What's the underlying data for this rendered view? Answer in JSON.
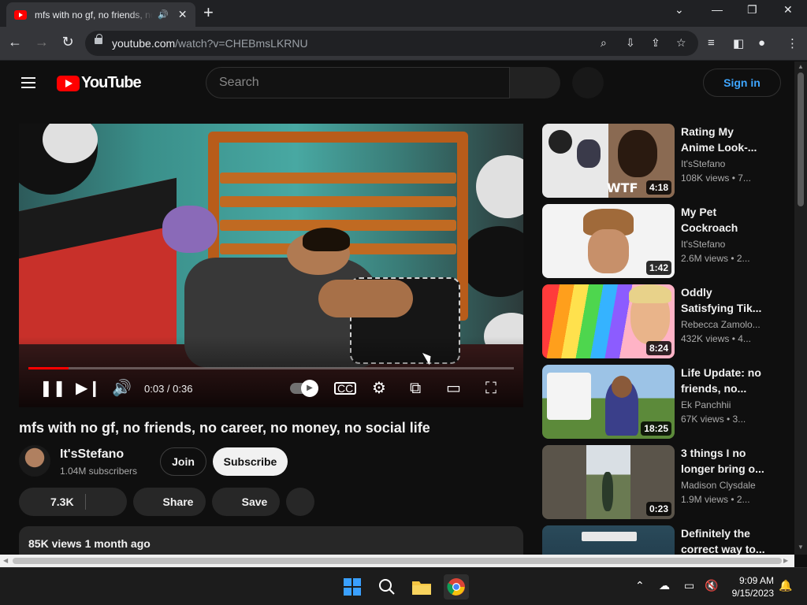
{
  "browser": {
    "tab_title": "mfs with no gf, no friends, no career, no money, no social life - YouTube",
    "url_host": "youtube.com",
    "url_path": "/watch?v=CHEBmsLKRNU"
  },
  "header": {
    "logo_text": "YouTube",
    "search_placeholder": "Search",
    "signin_label": "Sign in"
  },
  "player": {
    "time": "0:03 / 0:36",
    "progress": 0.083
  },
  "video": {
    "title": "mfs with no gf, no friends, no career, no money, no social life",
    "channel": "It'sStefano",
    "subscribers": "1.04M subscribers",
    "join_label": "Join",
    "subscribe_label": "Subscribe",
    "likes": "7.3K",
    "share_label": "Share",
    "save_label": "Save",
    "views_date": "85K views  1 month ago"
  },
  "recommendations": [
    {
      "title": "Rating My Anime Look-...",
      "channel": "It'sStefano",
      "meta": "108K views • 7...",
      "duration": "4:18"
    },
    {
      "title": "My Pet Cockroach",
      "channel": "It'sStefano",
      "meta": "2.6M views • 2...",
      "duration": "1:42"
    },
    {
      "title": "Oddly Satisfying Tik...",
      "channel": "Rebecca Zamolo...",
      "meta": "432K views • 4...",
      "duration": "8:24"
    },
    {
      "title": "Life Update: no friends, no...",
      "channel": "Ek Panchhii",
      "meta": "67K views • 3...",
      "duration": "18:25"
    },
    {
      "title": "3 things I no longer bring o...",
      "channel": "Madison Clysdale",
      "meta": "1.9M views • 2...",
      "duration": "0:23"
    },
    {
      "title": "Definitely the correct way to...",
      "channel": "",
      "meta": "",
      "duration": ""
    }
  ],
  "taskbar": {
    "time": "9:09 AM",
    "date": "9/15/2023"
  },
  "colors": {
    "youtube_red": "#ff0000",
    "link_blue": "#3ea6ff",
    "background": "#0f0f0f"
  }
}
